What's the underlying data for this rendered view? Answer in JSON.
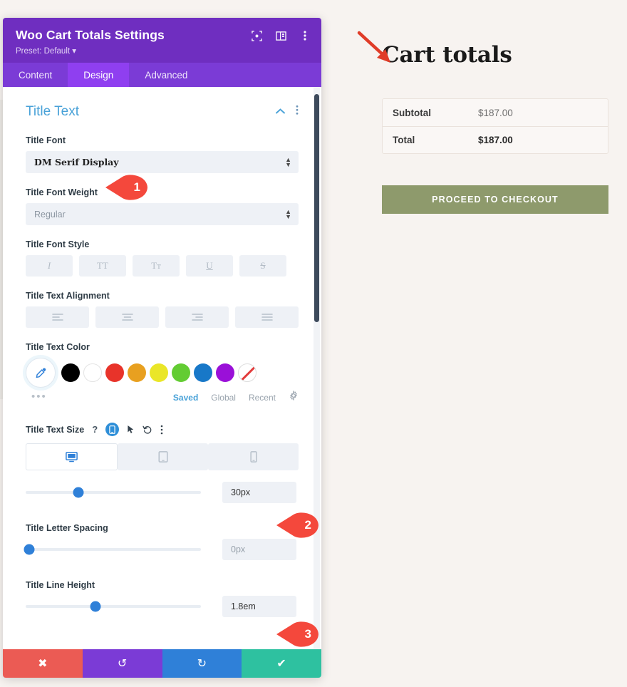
{
  "preview": {
    "cart_title": "Cart totals",
    "totals": [
      {
        "label": "Subtotal",
        "value": "$187.00",
        "emphasis": false
      },
      {
        "label": "Total",
        "value": "$187.00",
        "emphasis": true
      }
    ],
    "checkout_button": "PROCEED TO CHECKOUT",
    "colors": {
      "background": "#f7f3f0",
      "button": "#8e9a6c",
      "arrow": "#e03c28"
    }
  },
  "modal": {
    "title": "Woo Cart Totals Settings",
    "preset": "Preset: Default",
    "header_icons": [
      "focus-icon",
      "layout-panel-icon",
      "more-vertical-icon"
    ],
    "tabs": [
      {
        "label": "Content",
        "active": false
      },
      {
        "label": "Design",
        "active": true
      },
      {
        "label": "Advanced",
        "active": false
      }
    ],
    "colors": {
      "header": "#6f2ec0",
      "tabbar": "#7b3bd6",
      "tab_active": "#8f3ff0",
      "accent": "#49a2d8"
    }
  },
  "section": {
    "title": "Title Text",
    "collapse_icon": "chevron-up-icon",
    "options_icon": "more-vertical-icon"
  },
  "fields": {
    "title_font": {
      "label": "Title Font",
      "value": "DM Serif Display"
    },
    "title_font_weight": {
      "label": "Title Font Weight",
      "value": "Regular"
    },
    "title_font_style": {
      "label": "Title Font Style",
      "buttons": [
        {
          "glyph": "I",
          "name": "italic"
        },
        {
          "glyph": "TT",
          "name": "uppercase"
        },
        {
          "glyph": "Tт",
          "name": "small-caps"
        },
        {
          "glyph": "U",
          "name": "underline"
        },
        {
          "glyph": "S",
          "name": "strikethrough"
        }
      ]
    },
    "title_text_alignment": {
      "label": "Title Text Alignment",
      "buttons": [
        "align-left",
        "align-center",
        "align-right",
        "align-justify"
      ]
    },
    "title_text_color": {
      "label": "Title Text Color",
      "swatches": [
        "#000000",
        "#ffffff",
        "#e8332a",
        "#e8a020",
        "#eae628",
        "#63cc33",
        "#1878c8",
        "#9a10d8",
        "none"
      ],
      "tabs": [
        {
          "label": "Saved",
          "active": true
        },
        {
          "label": "Global",
          "active": false
        },
        {
          "label": "Recent",
          "active": false
        }
      ],
      "settings_icon": "gear-icon",
      "more_label": "•••"
    },
    "title_text_size": {
      "label": "Title Text Size",
      "value": "30px",
      "slider_percent": 30,
      "devices": [
        {
          "name": "desktop",
          "active": true
        },
        {
          "name": "tablet",
          "active": false
        },
        {
          "name": "phone",
          "active": false
        }
      ],
      "head_icons": [
        "help-icon",
        "responsive-toggle-icon",
        "hover-cursor-icon",
        "reset-icon",
        "more-vertical-icon"
      ]
    },
    "title_letter_spacing": {
      "label": "Title Letter Spacing",
      "value": "0px",
      "is_placeholder": true,
      "slider_percent": 2
    },
    "title_line_height": {
      "label": "Title Line Height",
      "value": "1.8em",
      "is_placeholder": false,
      "slider_percent": 40
    }
  },
  "callouts": [
    {
      "number": "1"
    },
    {
      "number": "2"
    },
    {
      "number": "3"
    }
  ],
  "footer": {
    "buttons": [
      {
        "name": "cancel",
        "glyph": "✖",
        "color": "#eb5b54"
      },
      {
        "name": "undo",
        "glyph": "↺",
        "color": "#7b3bd6"
      },
      {
        "name": "redo",
        "glyph": "↻",
        "color": "#2f80d8"
      },
      {
        "name": "save",
        "glyph": "✔",
        "color": "#2ec1a0"
      }
    ]
  }
}
